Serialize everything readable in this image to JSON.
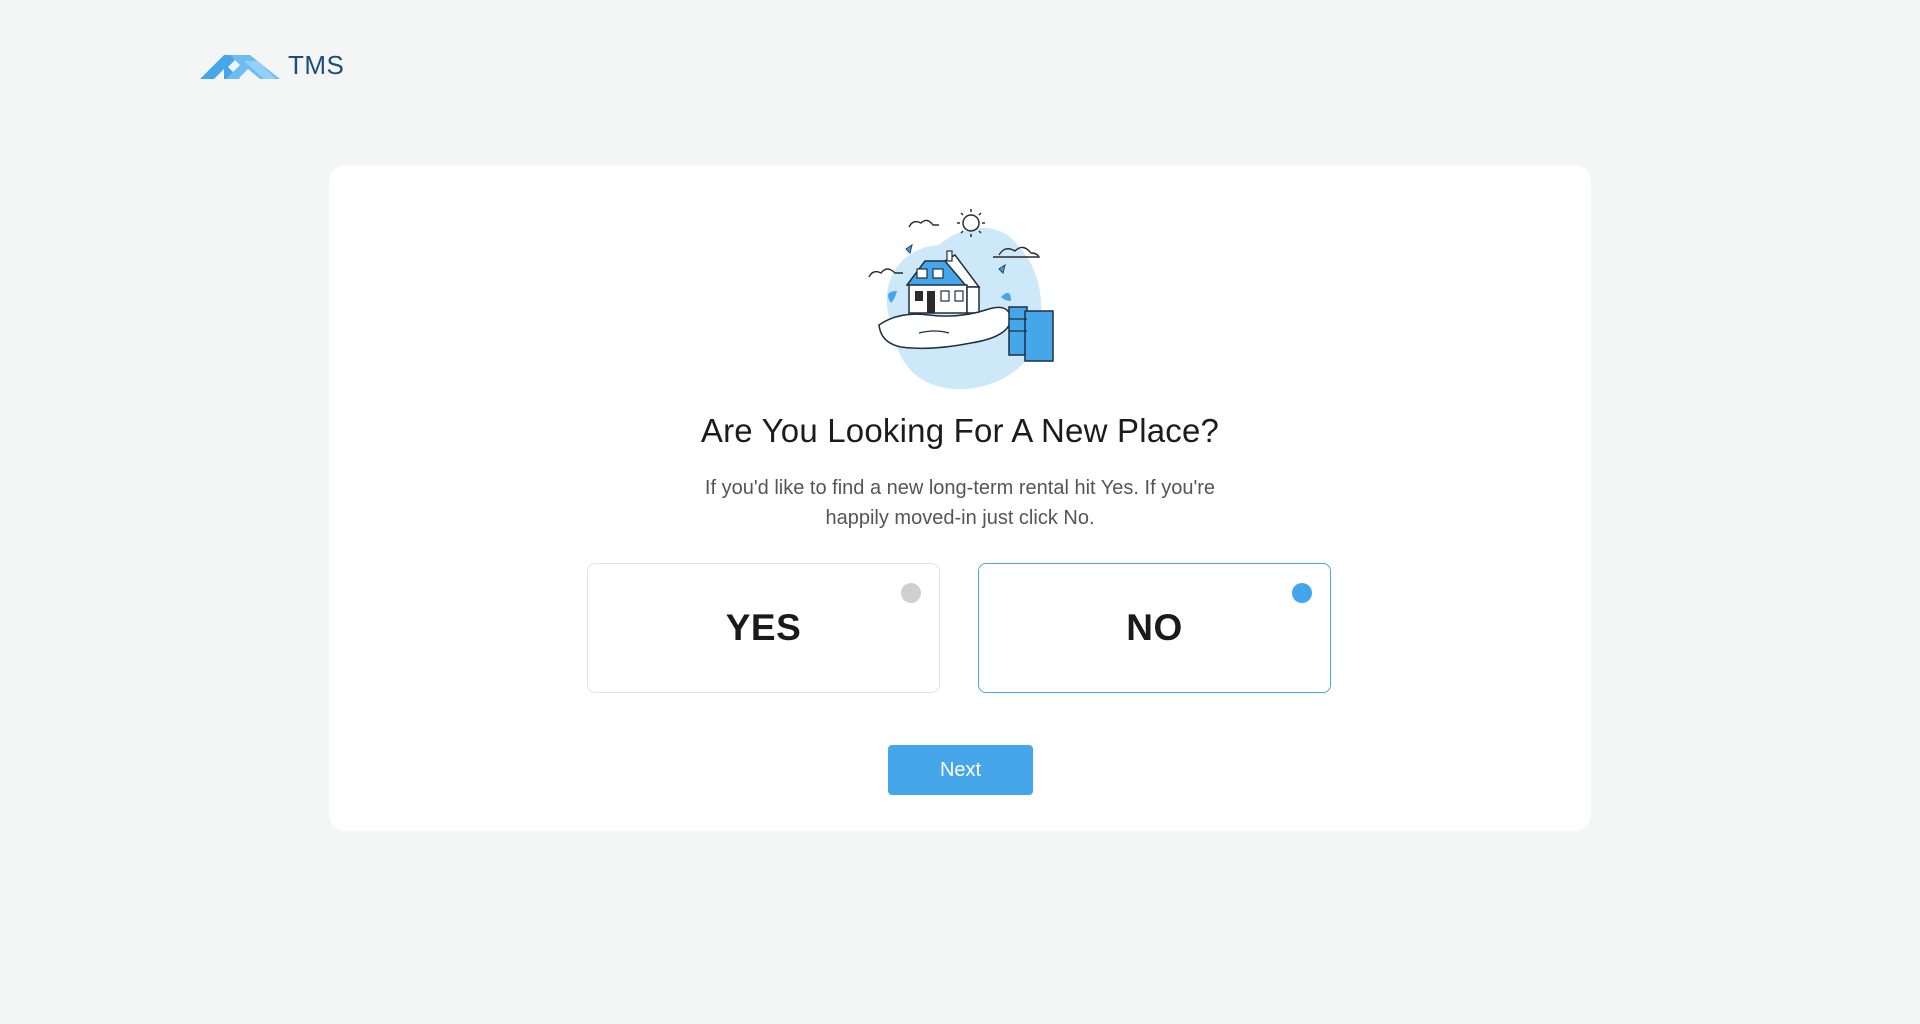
{
  "brand": {
    "name": "TMS",
    "logo_icon": "roof-logo-icon",
    "logo_color": "#45a7ea",
    "text_color": "#1a4f7a"
  },
  "illustration": {
    "icon": "house-in-hand-illustration"
  },
  "question": {
    "title": "Are You Looking For A New Place?",
    "subtitle": "If you'd like to find a new long-term rental hit Yes. If you're happily moved-in just click No."
  },
  "options": [
    {
      "label": "YES",
      "selected": false
    },
    {
      "label": "NO",
      "selected": true
    }
  ],
  "actions": {
    "next_label": "Next"
  },
  "colors": {
    "accent": "#45a7ea",
    "background": "#f4f5f5",
    "card": "#ffffff",
    "unselected_radio": "#cfcfcf"
  }
}
